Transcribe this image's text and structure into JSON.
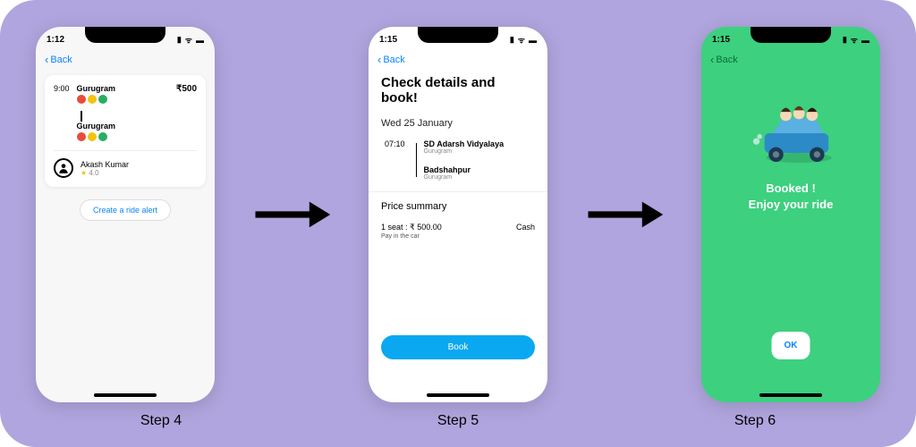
{
  "labels": {
    "step4": "Step 4",
    "step5": "Step 5",
    "step6": "Step 6"
  },
  "phone4": {
    "time": "1:12",
    "back": "Back",
    "ride": {
      "depart_time": "9:00",
      "price": "₹500",
      "from": "Gurugram",
      "to": "Gurugram"
    },
    "driver": {
      "name": "Akash Kumar",
      "rating": "4.0"
    },
    "alert_btn": "Create a ride alert"
  },
  "phone5": {
    "time": "1:15",
    "back": "Back",
    "title": "Check details and book!",
    "date": "Wed 25 January",
    "depart_time": "07:10",
    "from_name": "SD Adarsh Vidyalaya",
    "from_sub": "Gurugram",
    "to_name": "Badshahpur",
    "to_sub": "Gurugram",
    "price_head": "Price summary",
    "price_line": "1 seat : ₹ 500.00",
    "payment": "Cash",
    "pay_note": "Pay in the car",
    "book_btn": "Book"
  },
  "phone6": {
    "time": "1:15",
    "back": "Back",
    "line1": "Booked !",
    "line2": "Enjoy your ride",
    "ok": "OK"
  }
}
